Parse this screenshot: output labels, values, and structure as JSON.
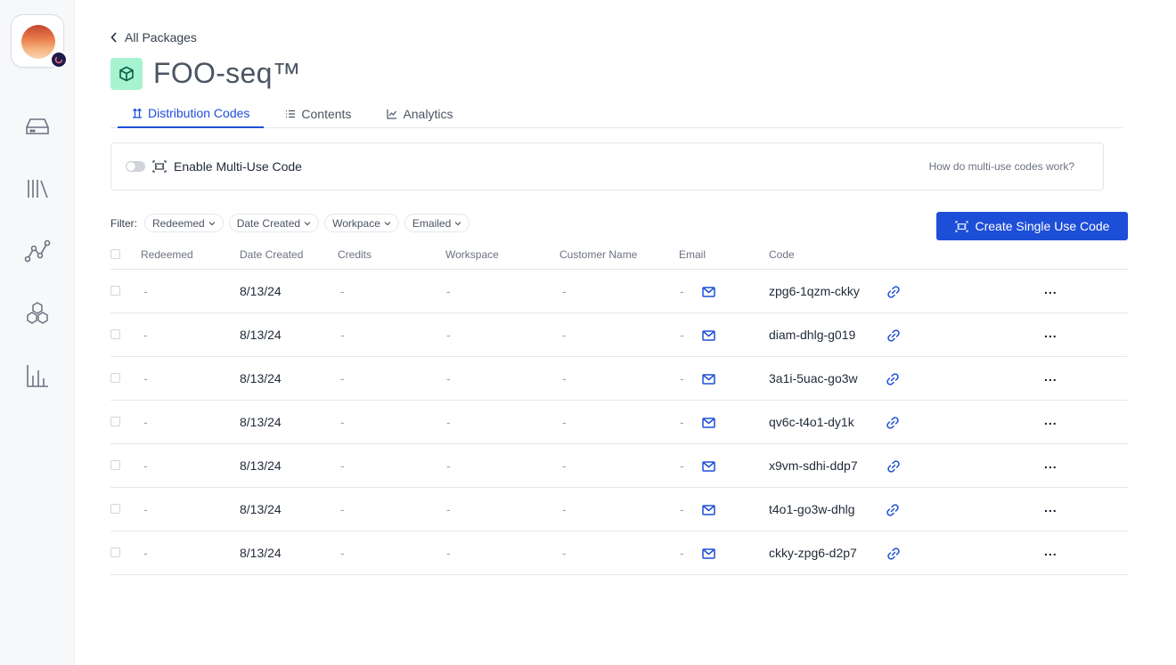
{
  "navigation": {
    "back_label": "All Packages"
  },
  "package": {
    "title": "FOO-seq™"
  },
  "tabs": [
    {
      "label": "Distribution Codes",
      "active": true
    },
    {
      "label": "Contents",
      "active": false
    },
    {
      "label": "Analytics",
      "active": false
    }
  ],
  "multi_use": {
    "label": "Enable Multi-Use Code",
    "enabled": false,
    "help_link": "How do multi-use codes work?"
  },
  "filter": {
    "label": "Filter:",
    "chips": [
      "Redeemed",
      "Date Created",
      "Workpace",
      "Emailed"
    ]
  },
  "actions": {
    "create_single_label": "Create Single Use Code"
  },
  "table": {
    "columns": [
      "Redeemed",
      "Date Created",
      "Credits",
      "Workspace",
      "Customer Name",
      "Email",
      "Code"
    ],
    "rows": [
      {
        "redeemed": "-",
        "date": "8/13/24",
        "credits": "-",
        "workspace": "-",
        "customer": "-",
        "email": "-",
        "code": "zpg6-1qzm-ckky"
      },
      {
        "redeemed": "-",
        "date": "8/13/24",
        "credits": "-",
        "workspace": "-",
        "customer": "-",
        "email": "-",
        "code": "diam-dhlg-g019"
      },
      {
        "redeemed": "-",
        "date": "8/13/24",
        "credits": "-",
        "workspace": "-",
        "customer": "-",
        "email": "-",
        "code": "3a1i-5uac-go3w"
      },
      {
        "redeemed": "-",
        "date": "8/13/24",
        "credits": "-",
        "workspace": "-",
        "customer": "-",
        "email": "-",
        "code": "qv6c-t4o1-dy1k"
      },
      {
        "redeemed": "-",
        "date": "8/13/24",
        "credits": "-",
        "workspace": "-",
        "customer": "-",
        "email": "-",
        "code": "x9vm-sdhi-ddp7"
      },
      {
        "redeemed": "-",
        "date": "8/13/24",
        "credits": "-",
        "workspace": "-",
        "customer": "-",
        "email": "-",
        "code": "t4o1-go3w-dhlg"
      },
      {
        "redeemed": "-",
        "date": "8/13/24",
        "credits": "-",
        "workspace": "-",
        "customer": "-",
        "email": "-",
        "code": "ckky-zpg6-d2p7"
      }
    ],
    "more_label": "..."
  },
  "colors": {
    "accent": "#1d4ed8",
    "package_icon_bg": "#a7f3d0"
  },
  "icons": {
    "sidebar": [
      "inbox-tray-icon",
      "library-icon",
      "graph-nodes-icon",
      "hexagons-icon",
      "bar-chart-icon"
    ],
    "row_email": "mail-icon",
    "row_link": "link-icon"
  }
}
